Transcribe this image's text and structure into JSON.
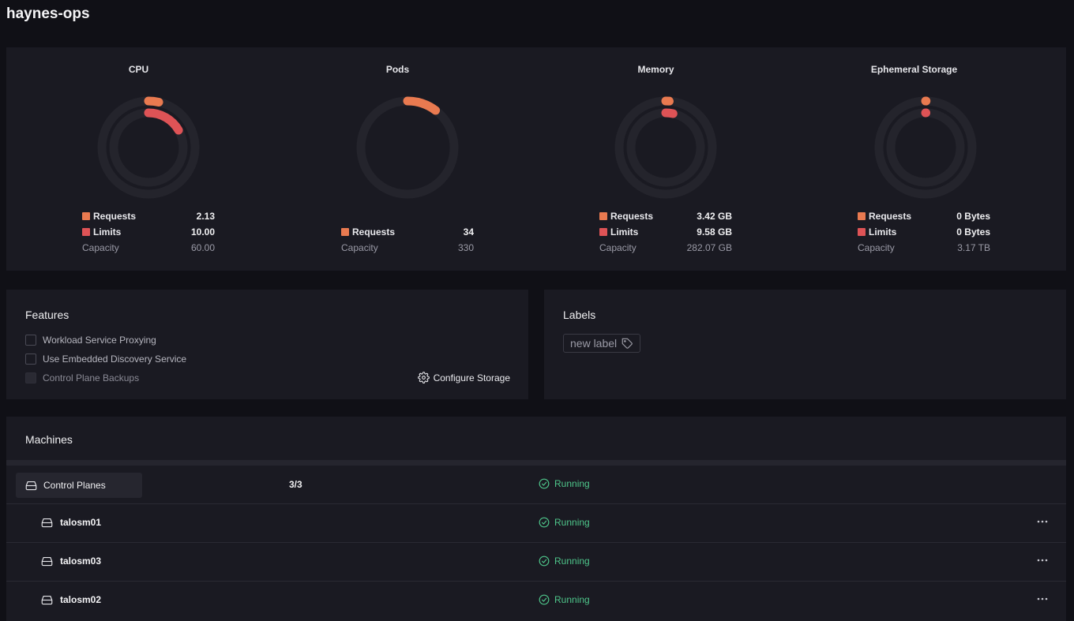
{
  "page": {
    "title": "haynes-ops"
  },
  "colors": {
    "requests": "#e97a50",
    "limits": "#de5356",
    "track": "#24242c",
    "running": "#4ec58a"
  },
  "stats": [
    {
      "title": "CPU",
      "requests": {
        "label": "Requests",
        "value": "2.13",
        "fraction": 0.0355
      },
      "limits": {
        "label": "Limits",
        "value": "10.00",
        "fraction": 0.1667
      },
      "capacity": {
        "label": "Capacity",
        "value": "60.00"
      }
    },
    {
      "title": "Pods",
      "requests": {
        "label": "Requests",
        "value": "34",
        "fraction": 0.103
      },
      "capacity": {
        "label": "Capacity",
        "value": "330"
      }
    },
    {
      "title": "Memory",
      "requests": {
        "label": "Requests",
        "value": "3.42 GB",
        "fraction": 0.0121
      },
      "limits": {
        "label": "Limits",
        "value": "9.58 GB",
        "fraction": 0.034
      },
      "capacity": {
        "label": "Capacity",
        "value": "282.07 GB"
      }
    },
    {
      "title": "Ephemeral Storage",
      "requests": {
        "label": "Requests",
        "value": "0 Bytes",
        "fraction": 0
      },
      "limits": {
        "label": "Limits",
        "value": "0 Bytes",
        "fraction": 0
      },
      "capacity": {
        "label": "Capacity",
        "value": "3.17 TB"
      }
    }
  ],
  "features": {
    "heading": "Features",
    "items": [
      {
        "label": "Workload Service Proxying",
        "checked": false,
        "disabled": false
      },
      {
        "label": "Use Embedded Discovery Service",
        "checked": false,
        "disabled": false
      },
      {
        "label": "Control Plane Backups",
        "checked": false,
        "disabled": true
      }
    ],
    "configure_storage": "Configure Storage"
  },
  "labels": {
    "heading": "Labels",
    "new_label": "new label"
  },
  "machines": {
    "heading": "Machines",
    "group": {
      "name": "Control Planes",
      "count": "3/3",
      "status": "Running"
    },
    "rows": [
      {
        "name": "talosm01",
        "status": "Running"
      },
      {
        "name": "talosm03",
        "status": "Running"
      },
      {
        "name": "talosm02",
        "status": "Running"
      }
    ]
  }
}
